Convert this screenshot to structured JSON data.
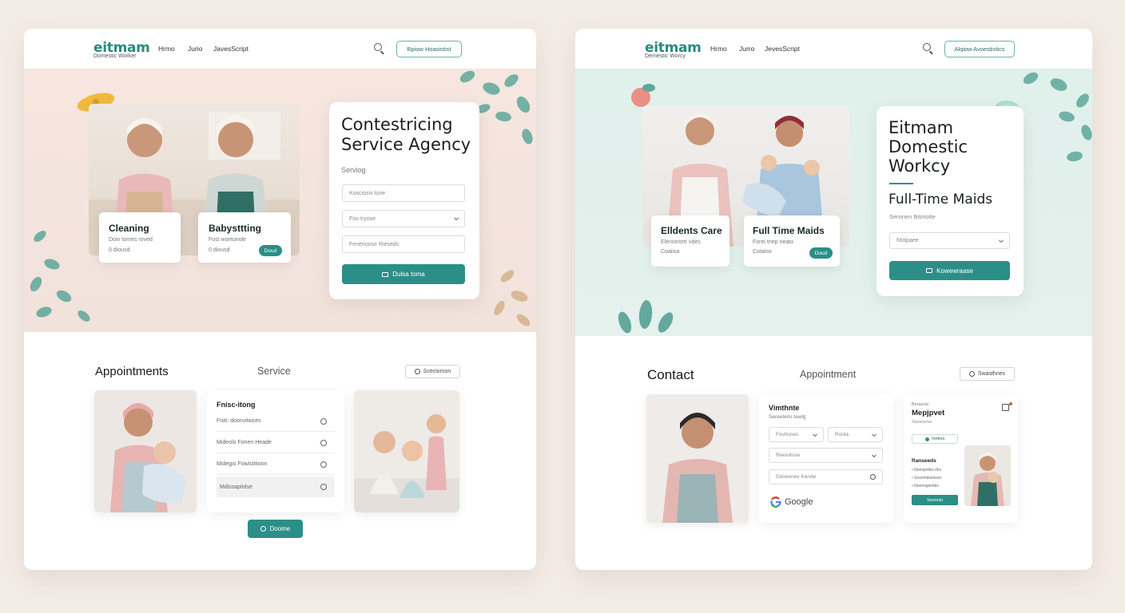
{
  "left": {
    "header": {
      "logo": "eitmam",
      "logo_tag": "Domestic Worker",
      "nav": [
        "Hrmo",
        "Jurio",
        "JavesScript"
      ],
      "action_label": "Bpiow Hoasistist"
    },
    "hero": {
      "cards": [
        {
          "title": "Cleaning",
          "sub": "Doin tomes roved",
          "meta": "0 diousd"
        },
        {
          "title": "Babysttting",
          "sub": "Fost wsetoriole",
          "meta": "0 diousd",
          "pill": "Doud"
        }
      ],
      "form": {
        "title_line1": "Contestricing",
        "title_line2": "Service Agency",
        "label": "Serviog",
        "fields": [
          "Kosciosiv tone",
          "Foo tryose",
          "Fenerioose Rieseds"
        ],
        "submit_label": "Dulsa toma"
      }
    },
    "section": {
      "title": "Appointments",
      "subtitle": "Service",
      "search_label": "Sceciorson",
      "list_title": "Fnisc-itong",
      "list_rows": [
        "Fniti: doonvitwces",
        "Mideolo Fonen Heade",
        "Midegio Fowistitioon",
        "Mdissaptidse"
      ],
      "primary_label": "Doome"
    }
  },
  "right": {
    "header": {
      "logo": "eitmam",
      "logo_tag": "Demestic Worcy",
      "nav": [
        "Hrmo",
        "Jurro",
        "JevesScript"
      ],
      "action_label": "Alqiow Avoestistics"
    },
    "hero": {
      "cards": [
        {
          "title": "Elldents Care",
          "sub": "Eleroorortr vdes",
          "meta": "Coaiisa",
          "pill": ""
        },
        {
          "title": "Full Time Maids",
          "sub": "Forei tnep neato",
          "meta": "Cotaiso",
          "pill": "Doud"
        }
      ],
      "form": {
        "title_line1": "Eitmam",
        "title_line2": "Domestic",
        "title_line3": "Workcy",
        "subtitle": "Full-Time Maids",
        "label": "Serorien Bitmotte",
        "select_value": "Nstipaee",
        "submit_label": "Kowewraase"
      }
    },
    "section": {
      "title": "Contact",
      "subtitle": "Appointment",
      "search_label": "Swasthnes",
      "form_card": {
        "title": "Vimthnte",
        "sub": "Sereeteris tewlg",
        "fields": [
          "Fovitones",
          "Roola",
          "Reesiitose",
          "Doneenev Kende"
        ],
        "google_label": "Google"
      },
      "profile_card": {
        "eyebrow": "Beraeriic",
        "title": "Mepjpvet",
        "sub": "Soxeceive",
        "chip": "Vetttes",
        "section": "Ranseeds",
        "items": [
          "Nonnpeliss ifes",
          "Sosetnitsetsser",
          "Nonmapesfec"
        ],
        "button": "Seoonts"
      }
    }
  },
  "colors": {
    "accent": "#2b8f87",
    "hero_left_bg": "#f6e6df",
    "hero_right_bg": "#e0f0eb",
    "page_bg": "#f3ece4"
  }
}
